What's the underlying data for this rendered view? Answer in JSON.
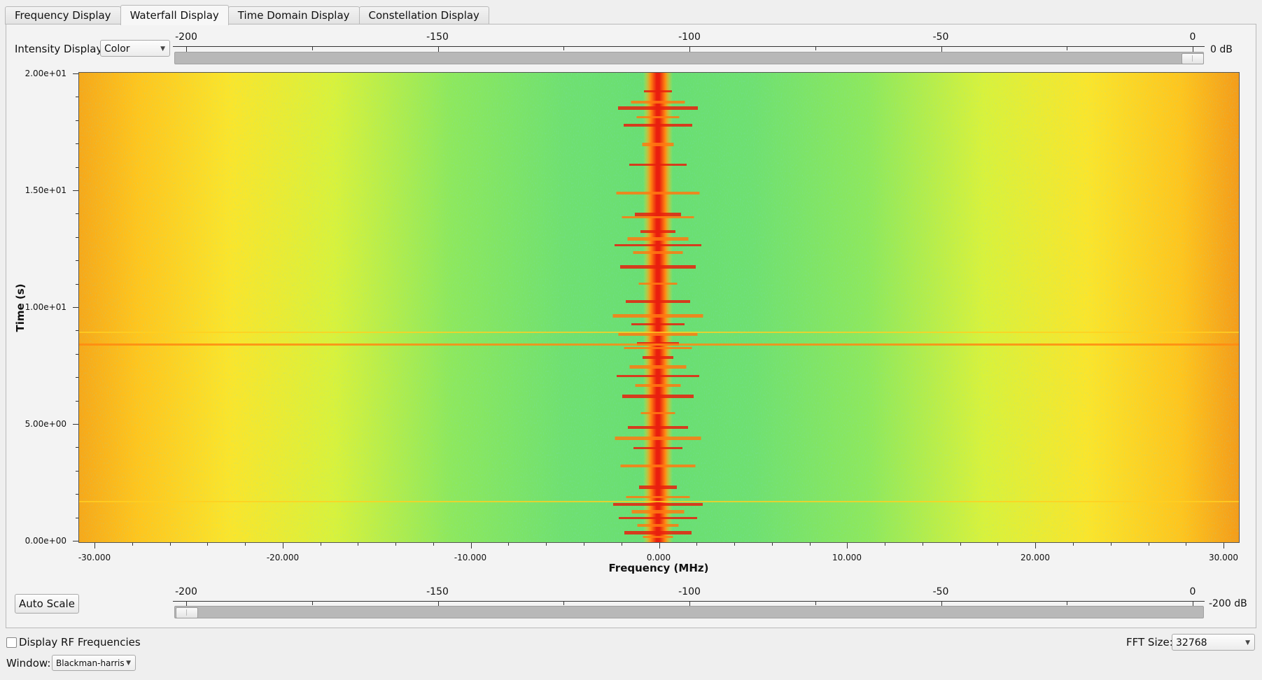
{
  "tabs": [
    {
      "label": "Frequency Display"
    },
    {
      "label": "Waterfall Display"
    },
    {
      "label": "Time Domain Display"
    },
    {
      "label": "Constellation Display"
    }
  ],
  "active_tab": 1,
  "intensity": {
    "label": "Intensity Display:",
    "value": "Color"
  },
  "top_scale": {
    "ticks": [
      "-200",
      "-150",
      "-100",
      "-50",
      "0"
    ],
    "db_label": "0 dB",
    "slider_value_db": 0
  },
  "bottom_scale": {
    "ticks": [
      "-200",
      "-150",
      "-100",
      "-50",
      "0"
    ],
    "db_label": "-200 dB",
    "slider_value_db": -200
  },
  "plot": {
    "y_axis_title": "Time (s)",
    "y_ticks": [
      "2.00e+01",
      "1.50e+01",
      "1.00e+01",
      "5.00e+00",
      "0.00e+00"
    ],
    "x_axis_title": "Frequency (MHz)",
    "x_ticks": [
      "-30.000",
      "-20.000",
      "-10.000",
      "0.000",
      "10.000",
      "20.000",
      "30.000"
    ]
  },
  "auto_scale_label": "Auto Scale",
  "rf_checkbox": {
    "label": "Display RF Frequencies",
    "checked": false
  },
  "window": {
    "label": "Window:",
    "value": "Blackman-harris"
  },
  "fft": {
    "label": "FFT Size:",
    "value": "32768"
  },
  "colors": {
    "background": "#efefef",
    "hot": "#e01010",
    "warm": "#ffd000",
    "cool": "#5fe06a"
  }
}
